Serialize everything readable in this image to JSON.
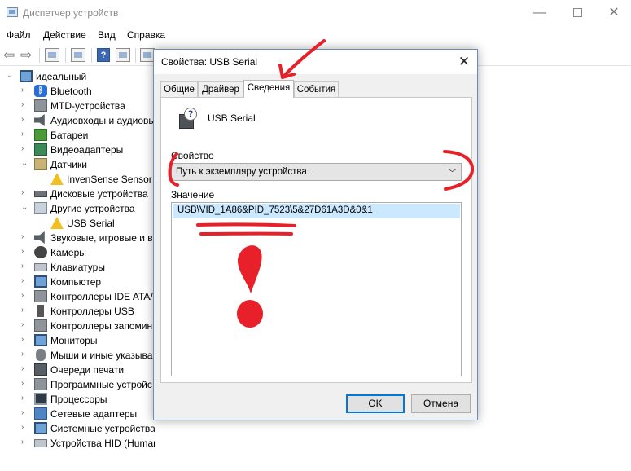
{
  "window": {
    "title": "Диспетчер устройств",
    "min_glyph": "—",
    "close_glyph": "✕"
  },
  "menu": [
    "Файл",
    "Действие",
    "Вид",
    "Справка"
  ],
  "toolbar": {
    "back_glyph": "⇦",
    "forward_glyph": "⇨",
    "help_glyph": "?"
  },
  "tree": {
    "root": "идеальный",
    "items": [
      {
        "label": "Bluetooth",
        "icon": "bluetooth-icon",
        "expanded": false
      },
      {
        "label": "MTD-устройства",
        "icon": "mtd-device-icon",
        "expanded": false
      },
      {
        "label": "Аудиовходы и аудиовы",
        "icon": "audio-icon",
        "expanded": false
      },
      {
        "label": "Батареи",
        "icon": "battery-icon",
        "expanded": false
      },
      {
        "label": "Видеоадаптеры",
        "icon": "display-adapter-icon",
        "expanded": false
      },
      {
        "label": "Датчики",
        "icon": "sensor-icon",
        "expanded": true
      },
      {
        "label": "InvenSense Sensor C",
        "icon": "warning-device-icon",
        "child": true
      },
      {
        "label": "Дисковые устройства",
        "icon": "disk-icon",
        "expanded": false
      },
      {
        "label": "Другие устройства",
        "icon": "unknown-device-icon",
        "expanded": true
      },
      {
        "label": "USB Serial",
        "icon": "warning-device-icon",
        "child": true
      },
      {
        "label": "Звуковые, игровые и в",
        "icon": "speaker-icon",
        "expanded": false
      },
      {
        "label": "Камеры",
        "icon": "camera-icon",
        "expanded": false
      },
      {
        "label": "Клавиатуры",
        "icon": "keyboard-icon",
        "expanded": false
      },
      {
        "label": "Компьютер",
        "icon": "computer-icon",
        "expanded": false
      },
      {
        "label": "Контроллеры IDE ATA/",
        "icon": "ide-controller-icon",
        "expanded": false
      },
      {
        "label": "Контроллеры USB",
        "icon": "usb-icon",
        "expanded": false
      },
      {
        "label": "Контроллеры запомин",
        "icon": "storage-controller-icon",
        "expanded": false
      },
      {
        "label": "Мониторы",
        "icon": "monitor-icon",
        "expanded": false
      },
      {
        "label": "Мыши и иные указыва",
        "icon": "mouse-icon",
        "expanded": false
      },
      {
        "label": "Очереди печати",
        "icon": "printer-icon",
        "expanded": false
      },
      {
        "label": "Программные устройс",
        "icon": "software-device-icon",
        "expanded": false
      },
      {
        "label": "Процессоры",
        "icon": "cpu-icon",
        "expanded": false
      },
      {
        "label": "Сетевые адаптеры",
        "icon": "network-adapter-icon",
        "expanded": false
      },
      {
        "label": "Системные устройства",
        "icon": "system-device-icon",
        "expanded": false
      },
      {
        "label": "Устройства HID (Human Interface Devices)",
        "icon": "hid-icon",
        "expanded": false
      }
    ]
  },
  "dialog": {
    "title": "Свойства: USB Serial",
    "close_glyph": "✕",
    "tabs": [
      "Общие",
      "Драйвер",
      "Сведения",
      "События"
    ],
    "active_tab": 2,
    "device_name": "USB Serial",
    "property_label": "Свойство",
    "property_value": "Путь к экземпляру устройства",
    "value_label": "Значение",
    "value": "USB\\VID_1A86&PID_7523\\5&27D61A3D&0&1",
    "ok_label": "OK",
    "cancel_label": "Отмена"
  },
  "colors": {
    "annotation": "#e8202a",
    "selection": "#cce8ff",
    "focus": "#0078d7"
  }
}
